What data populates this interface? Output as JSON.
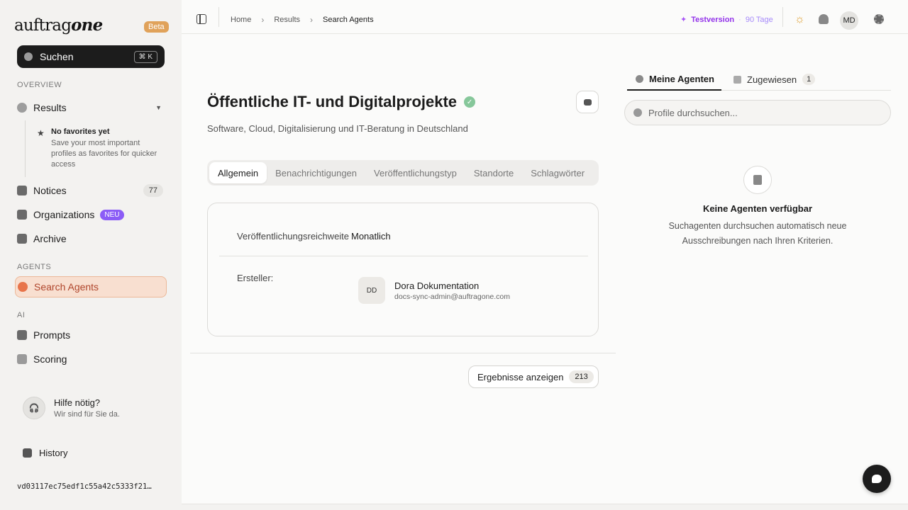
{
  "sidebar": {
    "logo_prefix": "auftrag",
    "logo_suffix": "one",
    "beta": "Beta",
    "search_label": "Suchen",
    "search_shortcut": "⌘ K",
    "overview_title": "OVERVIEW",
    "results_label": "Results",
    "favorites_title": "No favorites yet",
    "favorites_desc": "Save your most important profiles as favorites for quicker access",
    "notices_label": "Notices",
    "notices_count": "77",
    "organizations_label": "Organizations",
    "organizations_badge": "NEU",
    "archive_label": "Archive",
    "agents_title": "AGENTS",
    "search_agents_label": "Search Agents",
    "ai_title": "AI",
    "prompts_label": "Prompts",
    "scoring_label": "Scoring",
    "help_title": "Hilfe nötig?",
    "help_subtitle": "Wir sind für Sie da.",
    "history_label": "History",
    "hash": "vd03117ec75edf1c55a42c5333f21…"
  },
  "topbar": {
    "breadcrumb": [
      "Home",
      "Results",
      "Search Agents"
    ],
    "trial_label": "Testversion",
    "trial_days": "90 Tage",
    "avatar": "MD"
  },
  "agent": {
    "title": "Öffentliche IT- und Digitalprojekte",
    "subtitle": "Software, Cloud, Digitalisierung und IT-Beratung in Deutschland",
    "tabs": [
      "Allgemein",
      "Benachrichtigungen",
      "Veröffentlichungstyp",
      "Standorte",
      "Schlagwörter"
    ],
    "reach_label": "Veröffentlichungsreichweite",
    "reach_value": "Monatlich",
    "creator_label": "Ersteller:",
    "creator_initials": "DD",
    "creator_name": "Dora Dokumentation",
    "creator_email": "docs-sync-admin@auftragone.com",
    "results_button": "Ergebnisse anzeigen",
    "results_count": "213"
  },
  "right_panel": {
    "tab_mine": "Meine Agenten",
    "tab_assigned": "Zugewiesen",
    "assigned_count": "1",
    "search_placeholder": "Profile durchsuchen...",
    "empty_title": "Keine Agenten verfügbar",
    "empty_desc": "Suchagenten durchsuchen automatisch neue Ausschreibungen nach Ihren Kriterien."
  },
  "colors": {
    "accent": "#e8744a",
    "trial": "#9333ea",
    "beta": "#e0a25a",
    "verified": "#86c79a"
  }
}
